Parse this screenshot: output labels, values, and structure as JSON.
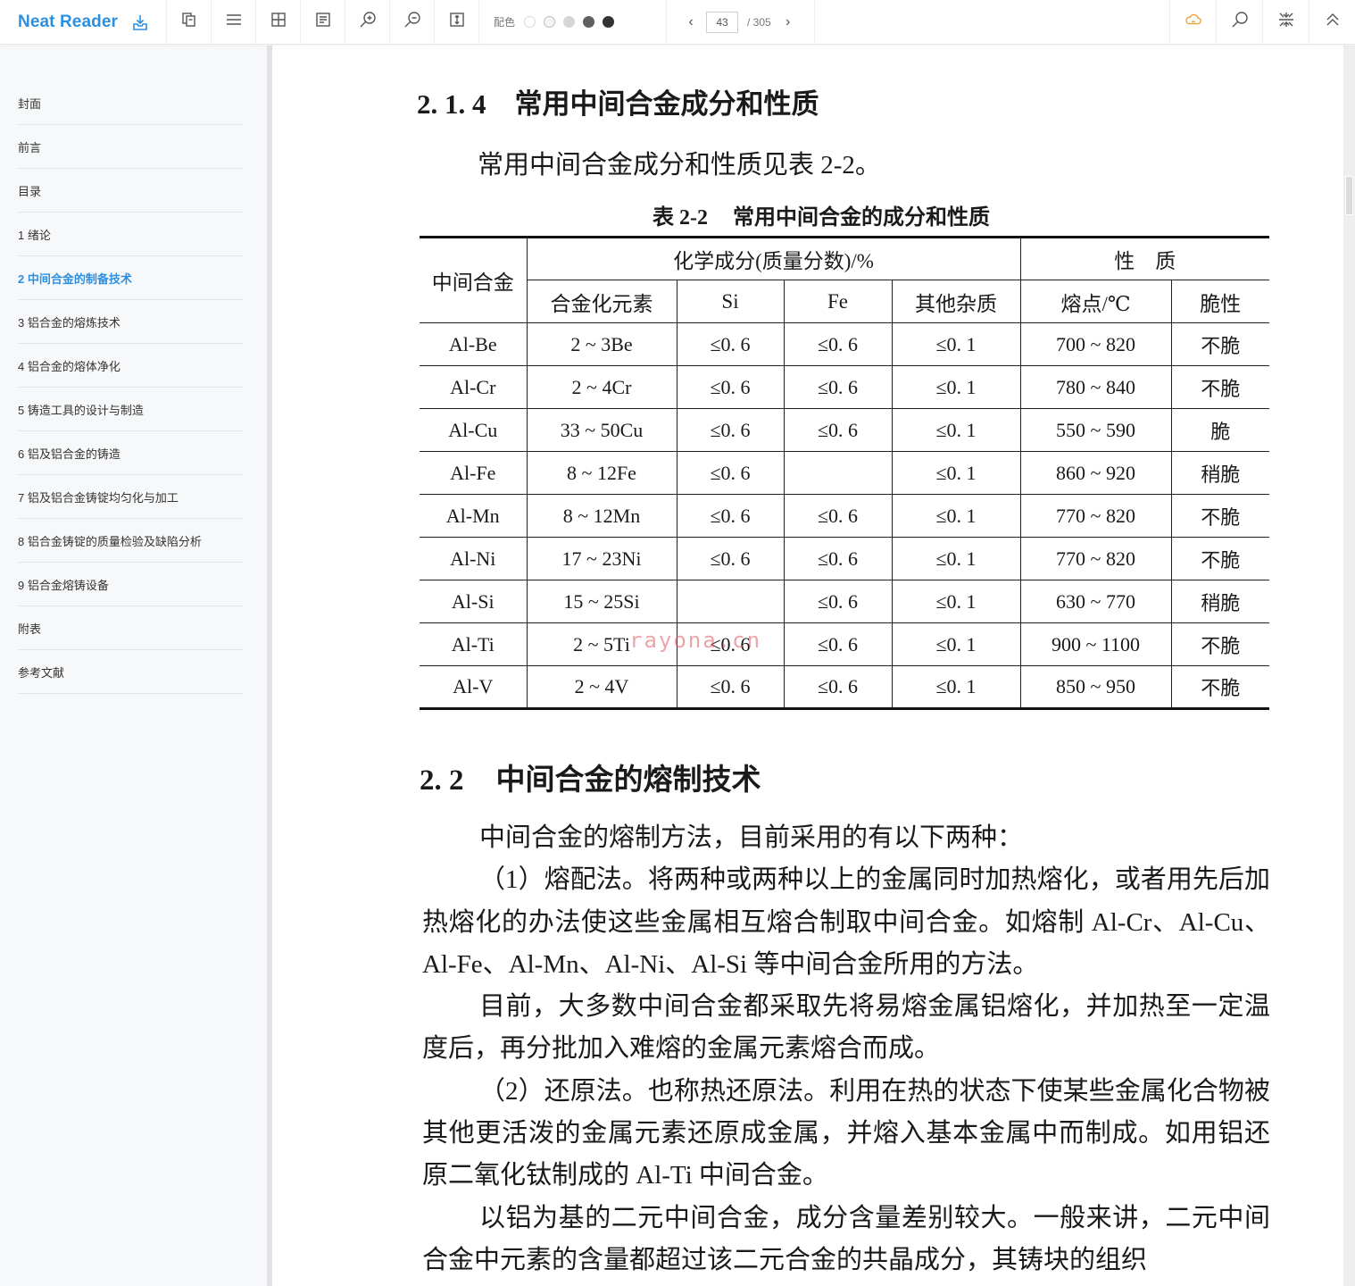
{
  "app": {
    "name": "Neat Reader",
    "accent_color": "#2d8fe0"
  },
  "toolbar": {
    "icons": [
      "download-icon",
      "copy-icon",
      "menu-icon",
      "grid-icon",
      "notes-icon",
      "zoom-in-icon",
      "zoom-out-icon",
      "fit-height-icon"
    ],
    "palette_label": "配色",
    "palette_colors": [
      "#ffffff",
      "#f2f2f2",
      "#d6d6d6",
      "#606060",
      "#333333"
    ],
    "current_page": "43",
    "total_pages": "/ 305",
    "right_icons": [
      "cloud-sync-icon",
      "search-icon",
      "collapse-icon",
      "scroll-top-icon"
    ]
  },
  "sidebar": {
    "toc": [
      {
        "label": "封面",
        "active": false
      },
      {
        "label": "前言",
        "active": false
      },
      {
        "label": "目录",
        "active": false
      },
      {
        "label": "1 绪论",
        "active": false
      },
      {
        "label": "2 中间合金的制备技术",
        "active": true
      },
      {
        "label": "3 铝合金的熔炼技术",
        "active": false
      },
      {
        "label": "4 铝合金的熔体净化",
        "active": false
      },
      {
        "label": "5 铸造工具的设计与制造",
        "active": false
      },
      {
        "label": "6 铝及铝合金的铸造",
        "active": false
      },
      {
        "label": "7 铝及铝合金铸锭均匀化与加工",
        "active": false
      },
      {
        "label": "8 铝合金铸锭的质量检验及缺陷分析",
        "active": false
      },
      {
        "label": "9 铝合金熔铸设备",
        "active": false
      },
      {
        "label": "附表",
        "active": false
      },
      {
        "label": "参考文献",
        "active": false
      }
    ]
  },
  "document": {
    "subsection": {
      "number": "2. 1. 4",
      "title": "常用中间合金成分和性质"
    },
    "intro": "常用中间合金成分和性质见表 2-2。",
    "table": {
      "caption_number": "表 2-2",
      "caption_title": "常用中间合金的成分和性质",
      "header_alloy": "中间合金",
      "header_chem": "化学成分(质量分数)/%",
      "header_props": "性　质",
      "sub_headers": [
        "合金化元素",
        "Si",
        "Fe",
        "其他杂质",
        "熔点/℃",
        "脆性"
      ],
      "rows": [
        [
          "Al-Be",
          "2 ~ 3Be",
          "≤0. 6",
          "≤0. 6",
          "≤0. 1",
          "700 ~ 820",
          "不脆"
        ],
        [
          "Al-Cr",
          "2 ~ 4Cr",
          "≤0. 6",
          "≤0. 6",
          "≤0. 1",
          "780 ~ 840",
          "不脆"
        ],
        [
          "Al-Cu",
          "33 ~ 50Cu",
          "≤0. 6",
          "≤0. 6",
          "≤0. 1",
          "550 ~ 590",
          "脆"
        ],
        [
          "Al-Fe",
          "8 ~ 12Fe",
          "≤0. 6",
          "",
          "≤0. 1",
          "860 ~ 920",
          "稍脆"
        ],
        [
          "Al-Mn",
          "8 ~ 12Mn",
          "≤0. 6",
          "≤0. 6",
          "≤0. 1",
          "770 ~ 820",
          "不脆"
        ],
        [
          "Al-Ni",
          "17 ~ 23Ni",
          "≤0. 6",
          "≤0. 6",
          "≤0. 1",
          "770 ~ 820",
          "不脆"
        ],
        [
          "Al-Si",
          "15 ~ 25Si",
          "",
          "≤0. 6",
          "≤0. 1",
          "630 ~ 770",
          "稍脆"
        ],
        [
          "Al-Ti",
          "2 ~ 5Ti",
          "≤0. 6",
          "≤0. 6",
          "≤0. 1",
          "900 ~ 1100",
          "不脆"
        ],
        [
          "Al-V",
          "2 ~ 4V",
          "≤0. 6",
          "≤0. 6",
          "≤0. 1",
          "850 ~ 950",
          "不脆"
        ]
      ]
    },
    "watermark": "rayona.cn",
    "section": {
      "number": "2. 2",
      "title": "中间合金的熔制技术"
    },
    "paragraphs": [
      "中间合金的熔制方法，目前采用的有以下两种：",
      "（1）熔配法。将两种或两种以上的金属同时加热熔化，或者用先后加热熔化的办法使这些金属相互熔合制取中间合金。如熔制 Al-Cr、Al-Cu、Al-Fe、Al-Mn、Al-Ni、Al-Si 等中间合金所用的方法。",
      "目前，大多数中间合金都采取先将易熔金属铝熔化，并加热至一定温度后，再分批加入难熔的金属元素熔合而成。",
      "（2）还原法。也称热还原法。利用在热的状态下使某些金属化合物被其他更活泼的金属元素还原成金属，并熔入基本金属中而制成。如用铝还原二氧化钛制成的 Al-Ti 中间合金。",
      "以铝为基的二元中间合金，成分含量差别较大。一般来讲，二元中间合金中元素的含量都超过该二元合金的共晶成分，其铸块的组织"
    ]
  }
}
